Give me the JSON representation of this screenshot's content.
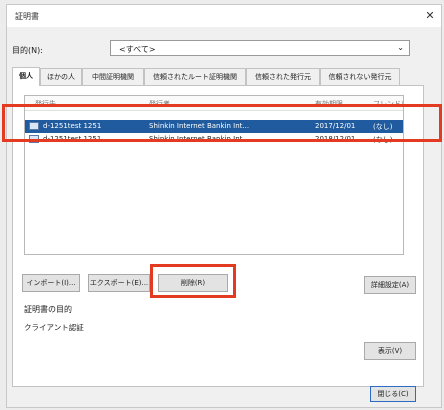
{
  "window": {
    "title": "証明書",
    "close_glyph": "✕"
  },
  "purpose": {
    "label": "目的(N):",
    "value": "<すべて>"
  },
  "tabs": [
    {
      "label": "個人"
    },
    {
      "label": "ほかの人"
    },
    {
      "label": "中間証明機関"
    },
    {
      "label": "信頼されたルート証明機関"
    },
    {
      "label": "信頼された発行元"
    },
    {
      "label": "信頼されない発行元"
    }
  ],
  "list": {
    "columns": [
      "発行先",
      "発行者",
      "有効期限",
      "フレンドリ名"
    ],
    "rows": [
      {
        "issued_to": "d-1251test 1251",
        "issued_by": "Shinkin Internet Bankin Int...",
        "expires": "2017/12/01",
        "friendly": "(なし)"
      },
      {
        "issued_to": "d-1251test 1251",
        "issued_by": "Shinkin Internet Bankin Int...",
        "expires": "2018/12/01",
        "friendly": "(なし)"
      }
    ]
  },
  "buttons": {
    "import": "インポート(I)...",
    "export": "エクスポート(E)...",
    "delete": "削除(R)",
    "advanced": "詳細設定(A)",
    "view": "表示(V)",
    "close": "閉じる(C)"
  },
  "purposes_section": {
    "label": "証明書の目的",
    "value": "クライアント認証"
  },
  "colors": {
    "highlight": "#e33a22",
    "selection": "#1f5b9e"
  },
  "icons": {
    "certificate": "certificate-icon",
    "dropdown": "chevron-down-icon",
    "close": "close-icon"
  }
}
